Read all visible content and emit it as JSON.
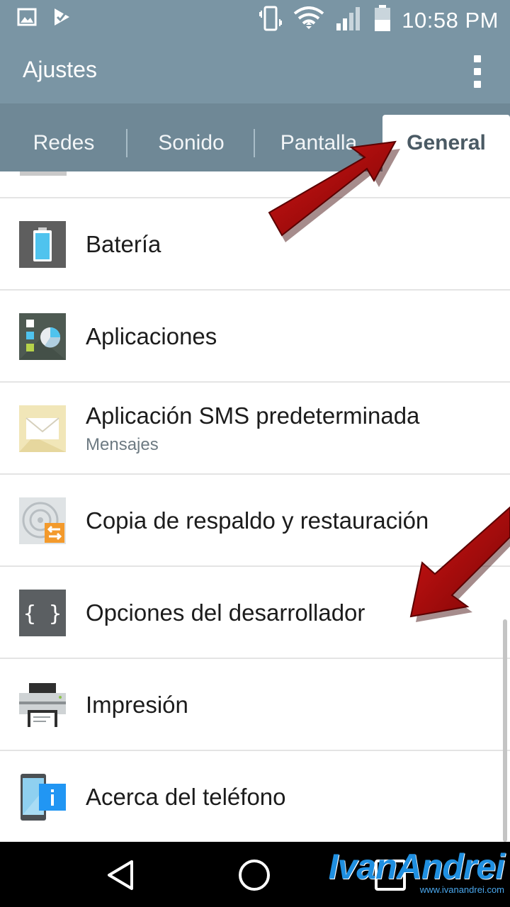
{
  "status_bar": {
    "time": "10:58 PM",
    "icons": [
      "gallery-icon",
      "notification-check-icon",
      "vibrate-icon",
      "wifi-icon",
      "signal-icon",
      "battery-icon"
    ]
  },
  "app": {
    "title": "Ajustes",
    "overflow_icon": "more-vert-icon",
    "header_color": "#7a95a4"
  },
  "tabs": [
    {
      "label": "Redes",
      "active": false
    },
    {
      "label": "Sonido",
      "active": false
    },
    {
      "label": "Pantalla",
      "active": false
    },
    {
      "label": "General",
      "active": true
    }
  ],
  "settings": [
    {
      "label": "Batería",
      "icon": "battery-setting-icon"
    },
    {
      "label": "Aplicaciones",
      "icon": "apps-setting-icon"
    },
    {
      "label": "Aplicación SMS predeterminada",
      "sub": "Mensajes",
      "icon": "sms-setting-icon"
    },
    {
      "label": "Copia de respaldo y restauración",
      "icon": "backup-setting-icon"
    },
    {
      "label": "Opciones del desarrollador",
      "icon": "developer-options-icon"
    },
    {
      "label": "Impresión",
      "icon": "printer-icon"
    },
    {
      "label": "Acerca del teléfono",
      "icon": "about-phone-icon"
    }
  ],
  "nav_bar": {
    "buttons": [
      "back-icon",
      "home-icon",
      "recents-icon"
    ]
  },
  "watermark": {
    "text": "IvanAndrei",
    "url": "www.ivanandrei.com"
  },
  "annotation_color": "#b30b0b"
}
